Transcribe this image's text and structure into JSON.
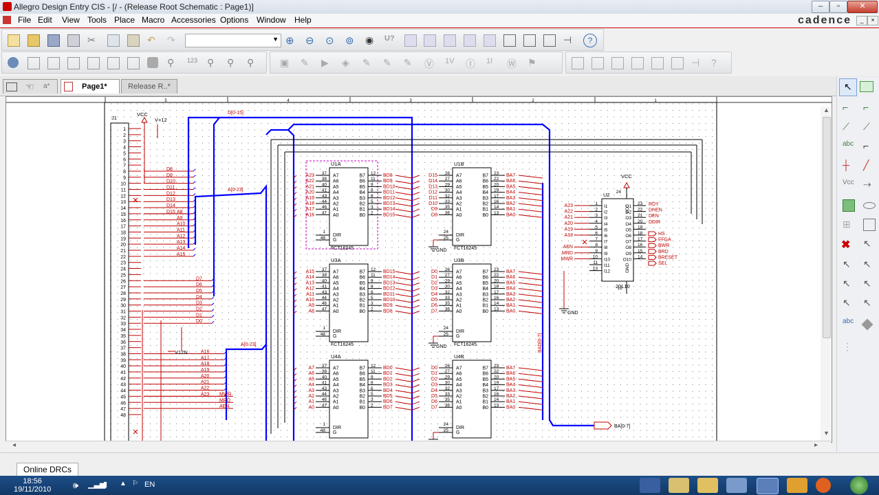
{
  "window": {
    "title": "Allegro Design Entry CIS - [/ - (Release Root Schematic : Page1)]",
    "brand": "cadence"
  },
  "menu": {
    "items": [
      "File",
      "Edit",
      "View",
      "Tools",
      "Place",
      "Macro",
      "Accessories",
      "Options",
      "Window",
      "Help"
    ]
  },
  "tabs": [
    {
      "label": "Page1*"
    },
    {
      "label": "Release R..*"
    }
  ],
  "schematic": {
    "colors": {
      "wire": "#0000ff",
      "pin": "#c00000",
      "body": "#000000",
      "bus_label": "#c00000"
    },
    "ruler": {
      "top": [
        "5",
        "4",
        "3",
        "2",
        "1"
      ]
    },
    "connector": {
      "ref": "J1",
      "pins": [
        "1",
        "2",
        "3",
        "4",
        "5",
        "6",
        "7",
        "8",
        "9",
        "10",
        "11",
        "12",
        "13",
        "14",
        "15",
        "16",
        "17",
        "18",
        "19",
        "20",
        "21",
        "22",
        "23",
        "24",
        "25",
        "26",
        "27",
        "28",
        "29",
        "30",
        "31",
        "32",
        "33",
        "34",
        "35",
        "36",
        "37",
        "38",
        "39",
        "40",
        "41",
        "42",
        "43",
        "44",
        "45",
        "46",
        "47",
        "48"
      ]
    },
    "power_labels": {
      "vcc": "VCC",
      "v12": "V+12",
      "v12n": "V12N",
      "gnd": "GND"
    },
    "bus_labels": {
      "d": "D[0-15]",
      "a": "A[0-23]",
      "a2": "A[0-23]",
      "bad": "BAD[0-7]",
      "ba": "BA[0-7]"
    },
    "j1_nets": {
      "d_hi": [
        "D8",
        "D9",
        "D10",
        "D11",
        "D12",
        "D13",
        "D14",
        "D15"
      ],
      "a_mid": [
        "A8",
        "A9",
        "A10",
        "A11",
        "A12",
        "A13",
        "A14",
        "A15"
      ],
      "d_lo": [
        "D7",
        "D6",
        "D5",
        "D4",
        "D3",
        "D2",
        "D1",
        "D0"
      ],
      "a_hi": [
        "A16",
        "A17",
        "A18",
        "A19",
        "A20",
        "A21",
        "A22",
        "A23"
      ],
      "ctl": [
        "MWR",
        "MRD",
        "AEN"
      ]
    },
    "buffers": [
      {
        "ref": "U1A",
        "part": "FCT16245",
        "in": [
          "A23",
          "A22",
          "A21",
          "A20",
          "A19",
          "A18",
          "A17",
          "A16"
        ],
        "out": [
          "BD8",
          "BD9",
          "BD10",
          "BD11",
          "BD12",
          "BD13",
          "BD14",
          "BD15"
        ],
        "in_pins": [
          "37",
          "38",
          "40",
          "41",
          "43",
          "44",
          "46",
          "47"
        ],
        "out_pins": [
          "12",
          "11",
          "9",
          "8",
          "6",
          "5",
          "3",
          "2"
        ],
        "ctl_pins": [
          "1",
          "48"
        ]
      },
      {
        "ref": "U3A",
        "part": "FCT16245",
        "in": [
          "A15",
          "A14",
          "A13",
          "A12",
          "A11",
          "A10",
          "A9",
          "A8"
        ],
        "out": [
          "BD15",
          "BD14",
          "BD13",
          "BD12",
          "BD11",
          "BD10",
          "BD9",
          "BD8"
        ],
        "in_pins": [
          "37",
          "38",
          "40",
          "41",
          "43",
          "44",
          "46",
          "47"
        ],
        "out_pins": [
          "12",
          "11",
          "9",
          "8",
          "6",
          "5",
          "3",
          "2"
        ],
        "ctl_pins": [
          "1",
          "48"
        ]
      },
      {
        "ref": "U4A",
        "part": "",
        "in": [
          "A7",
          "A6",
          "A5",
          "A4",
          "A3",
          "A2",
          "A1",
          "A0"
        ],
        "out": [
          "BD0",
          "BD1",
          "BD2",
          "BD3",
          "BD4",
          "BD5",
          "BD6",
          "BD7"
        ],
        "in_pins": [
          "37",
          "38",
          "40",
          "41",
          "43",
          "44",
          "46",
          "47"
        ],
        "out_pins": [
          "12",
          "11",
          "9",
          "8",
          "6",
          "5",
          "3",
          "2"
        ],
        "ctl_pins": [
          "1",
          "48"
        ]
      },
      {
        "ref": "U1B",
        "part": "FCT16245",
        "in": [
          "D15",
          "D14",
          "D13",
          "D12",
          "D11",
          "D10",
          "D9",
          "D8"
        ],
        "out": [
          "BA7",
          "BA6",
          "BA5",
          "BA4",
          "BA3",
          "BA2",
          "BA1",
          "BA0"
        ],
        "in_pins": [
          "26",
          "27",
          "29",
          "30",
          "32",
          "33",
          "35",
          "36"
        ],
        "out_pins": [
          "23",
          "22",
          "20",
          "19",
          "17",
          "16",
          "14",
          "13"
        ],
        "ctl_pins": [
          "24",
          "25"
        ]
      },
      {
        "ref": "U3B",
        "part": "FCT16245",
        "in": [
          "D0",
          "D1",
          "D2",
          "D3",
          "D4",
          "D5",
          "D6",
          "D7"
        ],
        "out": [
          "BA7",
          "BA6",
          "BA5",
          "BA4",
          "BA3",
          "BA2",
          "BA1",
          "BA0"
        ],
        "in_pins": [
          "26",
          "27",
          "29",
          "30",
          "32",
          "33",
          "35",
          "36"
        ],
        "out_pins": [
          "23",
          "22",
          "20",
          "19",
          "17",
          "16",
          "14",
          "13"
        ],
        "ctl_pins": [
          "24",
          "25"
        ]
      },
      {
        "ref": "U4B",
        "part": "",
        "in": [
          "D0",
          "D1",
          "D2",
          "D3",
          "D4",
          "D5",
          "D6",
          "D7"
        ],
        "out": [
          "BA7",
          "BA6",
          "BA5",
          "BA4",
          "BA3",
          "BA2",
          "BA1",
          "BA0"
        ],
        "in_pins": [
          "26",
          "27",
          "29",
          "30",
          "32",
          "33",
          "35",
          "36"
        ],
        "out_pins": [
          "23",
          "22",
          "20",
          "19",
          "17",
          "16",
          "14",
          "13"
        ],
        "ctl_pins": [
          "24",
          "25"
        ]
      }
    ],
    "buffer_pins_in": [
      "A7",
      "A6",
      "A5",
      "A4",
      "A3",
      "A2",
      "A1",
      "A0"
    ],
    "buffer_pins_out": [
      "B7",
      "B6",
      "B5",
      "B4",
      "B3",
      "B2",
      "B1",
      "B0"
    ],
    "buffer_ctl": [
      "DIR",
      "G"
    ],
    "pld": {
      "ref": "U2",
      "part": "20L10",
      "vcc_pin": "24",
      "gnd_pin": "12",
      "in_nets": [
        "A23",
        "A22",
        "A21",
        "A20",
        "A19",
        "A18",
        "",
        "AEN",
        "MRD",
        "MWR",
        "",
        ""
      ],
      "in_pin_numbers": [
        "1",
        "2",
        "3",
        "4",
        "5",
        "6",
        "7",
        "8",
        "9",
        "10",
        "11",
        "13"
      ],
      "in_pins": [
        "I1",
        "I2",
        "I3",
        "I4",
        "I5",
        "I6",
        "I7",
        "I8",
        "I9",
        "I10",
        "I11",
        "I12"
      ],
      "out_pin_numbers": [
        "23",
        "22",
        "21",
        "20",
        "19",
        "18",
        "17",
        "16",
        "15",
        "14"
      ],
      "out_pins": [
        "O1",
        "O2",
        "O3",
        "O4",
        "O5",
        "O6",
        "O7",
        "O8",
        "O9",
        "O10"
      ],
      "out_nets": [
        "RDY",
        "DHEN",
        "DEN",
        "DDIR",
        "",
        "HS",
        "FFGA",
        "BWR",
        "BRD",
        "BRESET",
        "SEL"
      ],
      "inner": [
        "VCC",
        "GND"
      ]
    }
  },
  "status": {
    "drc_label": "Online DRCs"
  },
  "taskbar": {
    "time": "18:56",
    "date": "19/11/2010",
    "lang": "EN"
  }
}
